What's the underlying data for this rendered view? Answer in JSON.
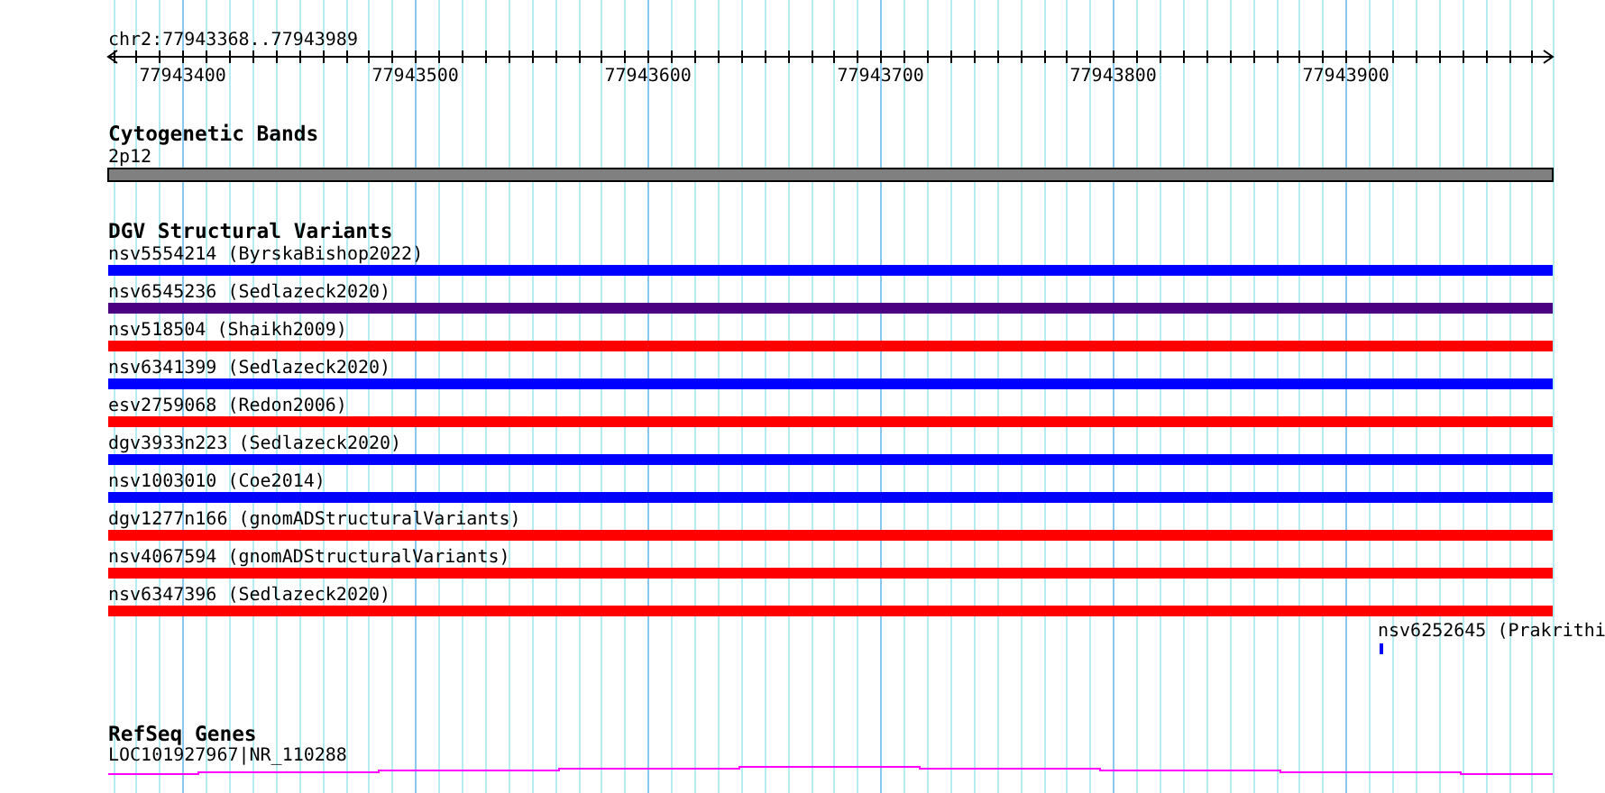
{
  "ruler": {
    "location": "chr2:77943368..77943989",
    "tick_labels": [
      "77943400",
      "77943500",
      "77943600",
      "77943700",
      "77943800",
      "77943900"
    ]
  },
  "tracks": [
    {
      "kind": "cytoband",
      "title": "Cytogenetic Bands",
      "features": [
        {
          "label": "2p12",
          "kind": "span"
        }
      ]
    },
    {
      "kind": "variants",
      "title": "DGV Structural Variants",
      "features": [
        {
          "label": "nsv5554214 (ByrskaBishop2022)",
          "kind": "span",
          "color": "#0000ff"
        },
        {
          "label": "nsv6545236 (Sedlazeck2020)",
          "kind": "span",
          "color": "#4b0082"
        },
        {
          "label": "nsv518504 (Shaikh2009)",
          "kind": "span",
          "color": "#ff0000"
        },
        {
          "label": "nsv6341399 (Sedlazeck2020)",
          "kind": "span",
          "color": "#0000ff"
        },
        {
          "label": "esv2759068 (Redon2006)",
          "kind": "span",
          "color": "#ff0000"
        },
        {
          "label": "dgv3933n223 (Sedlazeck2020)",
          "kind": "span",
          "color": "#0000ff"
        },
        {
          "label": "nsv1003010 (Coe2014)",
          "kind": "span",
          "color": "#0000ff"
        },
        {
          "label": "dgv1277n166 (gnomADStructuralVariants)",
          "kind": "span",
          "color": "#ff0000"
        },
        {
          "label": "nsv4067594 (gnomADStructuralVariants)",
          "kind": "span",
          "color": "#ff0000"
        },
        {
          "label": "nsv6347396 (Sedlazeck2020)",
          "kind": "span",
          "color": "#ff0000"
        },
        {
          "label": "nsv6252645 (Prakrithi",
          "kind": "point",
          "color": "#0000ff"
        }
      ]
    },
    {
      "kind": "gene",
      "title": "RefSeq Genes",
      "features": [
        {
          "label": "LOC101927967|NR_110288",
          "kind": "span"
        }
      ]
    }
  ]
}
